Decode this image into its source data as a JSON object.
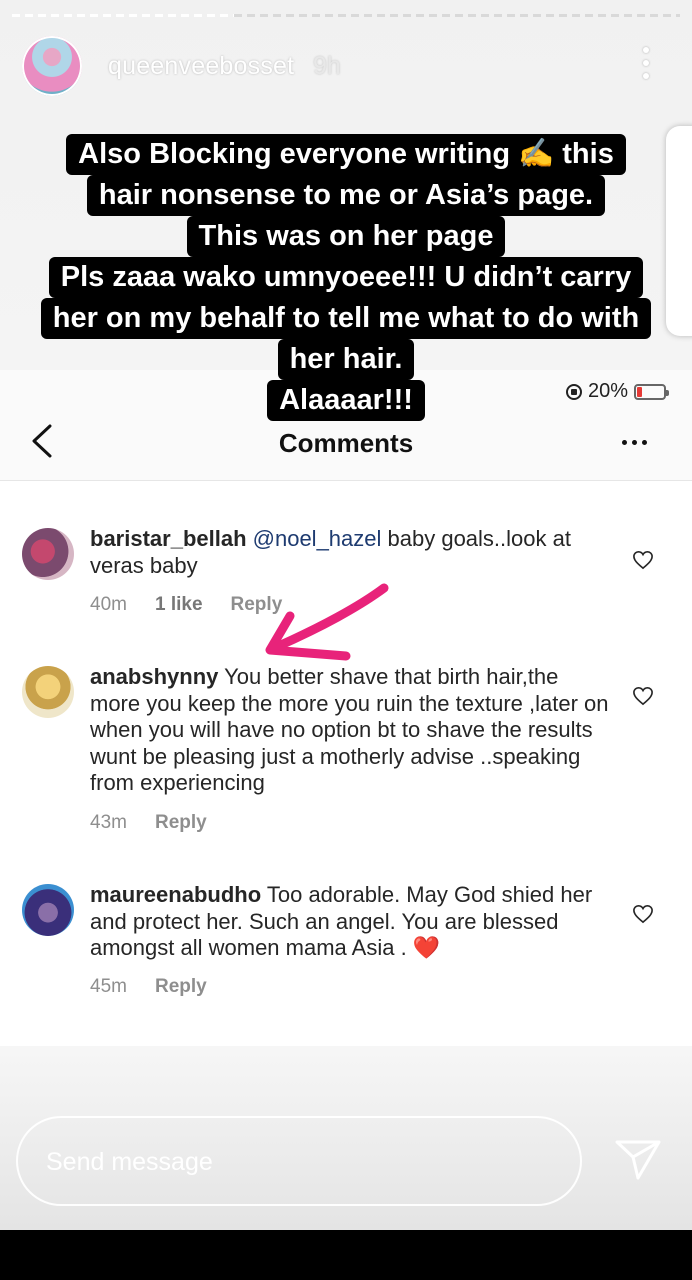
{
  "story": {
    "username": "queenveebosset",
    "time": "9h",
    "caption_lines": [
      "Also Blocking everyone writing ✍️ this",
      "hair nonsense to me or Asia’s page.",
      "This was on her page",
      "Pls zaaa wako umnyoeee!!! U didn’t carry",
      "her on my behalf to tell me what to do with",
      "her hair.",
      "Alaaaar!!!"
    ]
  },
  "status_bar": {
    "battery": "20%"
  },
  "comments_header": {
    "title": "Comments"
  },
  "comments": [
    {
      "username": "baristar_bellah",
      "mention": "@noel_hazel",
      "text": " baby goals..look at veras baby",
      "time": "40m",
      "likes": "1 like",
      "reply": "Reply"
    },
    {
      "username": "anabshynny",
      "text": "You better shave that birth hair,the more you keep the more you ruin the texture ,later on when you will have no option bt to  shave the results wunt be pleasing just a motherly advise ..speaking from experiencing",
      "time": "43m",
      "reply": "Reply"
    },
    {
      "username": "maureenabudho",
      "text": "Too adorable. May God shied her and protect her. Such an angel. You are blessed amongst all women mama Asia . ❤️",
      "time": "45m",
      "reply": "Reply"
    }
  ],
  "send": {
    "placeholder": "Send message"
  },
  "colors": {
    "mention": "#1e3b70",
    "arrow": "#e8237a",
    "battery_low": "#e53935"
  }
}
